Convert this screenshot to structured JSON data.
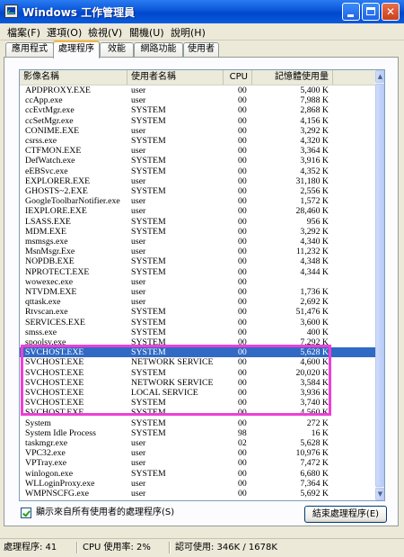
{
  "window": {
    "title": "Windows 工作管理員"
  },
  "menu": [
    "檔案(F)",
    "選項(O)",
    "檢視(V)",
    "關機(U)",
    "說明(H)"
  ],
  "tabs": [
    "應用程式",
    "處理程序",
    "效能",
    "網路功能",
    "使用者"
  ],
  "active_tab": "處理程序",
  "columns": [
    "影像名稱",
    "使用者名稱",
    "CPU",
    "記憶體使用量"
  ],
  "processes": [
    {
      "name": "APDPROXY.EXE",
      "user": "user",
      "cpu": "00",
      "mem": "5,400 K"
    },
    {
      "name": "ccApp.exe",
      "user": "user",
      "cpu": "00",
      "mem": "7,988 K"
    },
    {
      "name": "ccEvtMgr.exe",
      "user": "SYSTEM",
      "cpu": "00",
      "mem": "2,868 K"
    },
    {
      "name": "ccSetMgr.exe",
      "user": "SYSTEM",
      "cpu": "00",
      "mem": "4,156 K"
    },
    {
      "name": "CONIME.EXE",
      "user": "user",
      "cpu": "00",
      "mem": "3,292 K"
    },
    {
      "name": "csrss.exe",
      "user": "SYSTEM",
      "cpu": "00",
      "mem": "4,320 K"
    },
    {
      "name": "CTFMON.EXE",
      "user": "user",
      "cpu": "00",
      "mem": "3,364 K"
    },
    {
      "name": "DefWatch.exe",
      "user": "SYSTEM",
      "cpu": "00",
      "mem": "3,916 K"
    },
    {
      "name": "eEBSvc.exe",
      "user": "SYSTEM",
      "cpu": "00",
      "mem": "4,352 K"
    },
    {
      "name": "EXPLORER.EXE",
      "user": "user",
      "cpu": "00",
      "mem": "31,180 K"
    },
    {
      "name": "GHOSTS~2.EXE",
      "user": "SYSTEM",
      "cpu": "00",
      "mem": "2,556 K"
    },
    {
      "name": "GoogleToolbarNotifier.exe",
      "user": "user",
      "cpu": "00",
      "mem": "1,572 K"
    },
    {
      "name": "IEXPLORE.EXE",
      "user": "user",
      "cpu": "00",
      "mem": "28,460 K"
    },
    {
      "name": "LSASS.EXE",
      "user": "SYSTEM",
      "cpu": "00",
      "mem": "956 K"
    },
    {
      "name": "MDM.EXE",
      "user": "SYSTEM",
      "cpu": "00",
      "mem": "3,292 K"
    },
    {
      "name": "msmsgs.exe",
      "user": "user",
      "cpu": "00",
      "mem": "4,340 K"
    },
    {
      "name": "MsnMsgr.Exe",
      "user": "user",
      "cpu": "00",
      "mem": "11,232 K"
    },
    {
      "name": "NOPDB.EXE",
      "user": "SYSTEM",
      "cpu": "00",
      "mem": "4,348 K"
    },
    {
      "name": "NPROTECT.EXE",
      "user": "SYSTEM",
      "cpu": "00",
      "mem": "4,344 K"
    },
    {
      "name": "  wowexec.exe",
      "user": "user",
      "cpu": "00",
      "mem": ""
    },
    {
      "name": "NTVDM.EXE",
      "user": "user",
      "cpu": "00",
      "mem": "1,736 K"
    },
    {
      "name": "qttask.exe",
      "user": "user",
      "cpu": "00",
      "mem": "2,692 K"
    },
    {
      "name": "Rtvscan.exe",
      "user": "SYSTEM",
      "cpu": "00",
      "mem": "51,476 K"
    },
    {
      "name": "SERVICES.EXE",
      "user": "SYSTEM",
      "cpu": "00",
      "mem": "3,600 K"
    },
    {
      "name": "smss.exe",
      "user": "SYSTEM",
      "cpu": "00",
      "mem": "400 K"
    },
    {
      "name": "spoolsv.exe",
      "user": "SYSTEM",
      "cpu": "00",
      "mem": "7,292 K"
    },
    {
      "name": "SVCHOST.EXE",
      "user": "SYSTEM",
      "cpu": "00",
      "mem": "5,628 K",
      "selected": true
    },
    {
      "name": "SVCHOST.EXE",
      "user": "NETWORK SERVICE",
      "cpu": "00",
      "mem": "4,600 K"
    },
    {
      "name": "SVCHOST.EXE",
      "user": "SYSTEM",
      "cpu": "00",
      "mem": "20,020 K"
    },
    {
      "name": "SVCHOST.EXE",
      "user": "NETWORK SERVICE",
      "cpu": "00",
      "mem": "3,584 K"
    },
    {
      "name": "SVCHOST.EXE",
      "user": "LOCAL SERVICE",
      "cpu": "00",
      "mem": "3,936 K"
    },
    {
      "name": "SVCHOST.EXE",
      "user": "SYSTEM",
      "cpu": "00",
      "mem": "3,740 K"
    },
    {
      "name": "SVCHOST.EXE",
      "user": "SYSTEM",
      "cpu": "00",
      "mem": "4,560 K"
    },
    {
      "name": "System",
      "user": "SYSTEM",
      "cpu": "00",
      "mem": "272 K"
    },
    {
      "name": "System Idle Process",
      "user": "SYSTEM",
      "cpu": "98",
      "mem": "16 K"
    },
    {
      "name": "taskmgr.exe",
      "user": "user",
      "cpu": "02",
      "mem": "5,628 K"
    },
    {
      "name": "VPC32.exe",
      "user": "user",
      "cpu": "00",
      "mem": "10,976 K"
    },
    {
      "name": "VPTray.exe",
      "user": "user",
      "cpu": "00",
      "mem": "7,472 K"
    },
    {
      "name": "winlogon.exe",
      "user": "SYSTEM",
      "cpu": "00",
      "mem": "6,680 K"
    },
    {
      "name": "WLLoginProxy.exe",
      "user": "user",
      "cpu": "00",
      "mem": "7,364 K"
    },
    {
      "name": "WMPNSCFG.exe",
      "user": "user",
      "cpu": "00",
      "mem": "5,692 K"
    }
  ],
  "show_all_users": {
    "label": "顯示來自所有使用者的處理程序(S)",
    "checked": true
  },
  "end_process_button": "結束處理程序(E)",
  "status": {
    "processes": "處理程序: 41",
    "cpu": "CPU 使用率: 2%",
    "commit": "認可使用: 346K / 1678K"
  },
  "colors": {
    "title_bar": "#0a55d8",
    "selection": "#316ac5",
    "highlight_frame": "#ef3fd6",
    "tab_accent": "#f7b73d"
  },
  "icons": [
    "app-icon",
    "minimize-icon",
    "maximize-icon",
    "close-icon",
    "scroll-up-icon",
    "scroll-down-icon"
  ]
}
